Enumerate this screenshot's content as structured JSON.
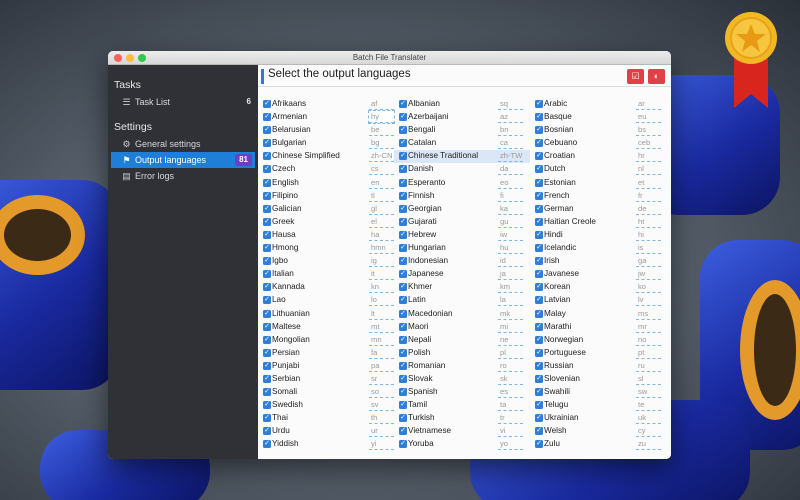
{
  "window": {
    "title": "Batch File Translater"
  },
  "sidebar": {
    "sections": [
      {
        "label": "Tasks",
        "items": [
          {
            "label": "Task List",
            "icon": "list-icon",
            "count": "6"
          }
        ]
      },
      {
        "label": "Settings",
        "items": [
          {
            "label": "General settings",
            "icon": "gear-icon"
          },
          {
            "label": "Output languages",
            "icon": "flag-icon",
            "count": "81",
            "selected": true
          },
          {
            "label": "Error logs",
            "icon": "document-icon"
          }
        ]
      }
    ]
  },
  "main": {
    "title": "Select the output languages",
    "buttons": [
      {
        "icon": "check-icon"
      },
      {
        "icon": "toggle-icon"
      }
    ],
    "accent": "#2f78d6"
  },
  "languages": [
    [
      [
        "Afrikaans",
        "af"
      ],
      [
        "Armenian",
        "hy"
      ],
      [
        "Belarusian",
        "be"
      ],
      [
        "Bulgarian",
        "bg"
      ],
      [
        "Chinese Simplified",
        "zh-CN"
      ],
      [
        "Czech",
        "cs"
      ],
      [
        "English",
        "en"
      ],
      [
        "Filipino",
        "tl"
      ],
      [
        "Galician",
        "gl"
      ],
      [
        "Greek",
        "el"
      ],
      [
        "Hausa",
        "ha"
      ],
      [
        "Hmong",
        "hmn"
      ],
      [
        "Igbo",
        "ig"
      ],
      [
        "Italian",
        "it"
      ],
      [
        "Kannada",
        "kn"
      ],
      [
        "Lao",
        "lo"
      ],
      [
        "Lithuanian",
        "lt"
      ],
      [
        "Maltese",
        "mt"
      ],
      [
        "Mongolian",
        "mn"
      ],
      [
        "Persian",
        "fa"
      ],
      [
        "Punjabi",
        "pa"
      ],
      [
        "Serbian",
        "sr"
      ],
      [
        "Somali",
        "so"
      ],
      [
        "Swedish",
        "sv"
      ],
      [
        "Thai",
        "th"
      ],
      [
        "Urdu",
        "ur"
      ],
      [
        "Yiddish",
        "yi"
      ]
    ],
    [
      [
        "Albanian",
        "sq"
      ],
      [
        "Azerbaijani",
        "az"
      ],
      [
        "Bengali",
        "bn"
      ],
      [
        "Catalan",
        "ca"
      ],
      [
        "Chinese Traditional",
        "zh-TW"
      ],
      [
        "Danish",
        "da"
      ],
      [
        "Esperanto",
        "eo"
      ],
      [
        "Finnish",
        "fi"
      ],
      [
        "Georgian",
        "ka"
      ],
      [
        "Gujarati",
        "gu"
      ],
      [
        "Hebrew",
        "iw"
      ],
      [
        "Hungarian",
        "hu"
      ],
      [
        "Indonesian",
        "id"
      ],
      [
        "Japanese",
        "ja"
      ],
      [
        "Khmer",
        "km"
      ],
      [
        "Latin",
        "la"
      ],
      [
        "Macedonian",
        "mk"
      ],
      [
        "Maori",
        "mi"
      ],
      [
        "Nepali",
        "ne"
      ],
      [
        "Polish",
        "pl"
      ],
      [
        "Romanian",
        "ro"
      ],
      [
        "Slovak",
        "sk"
      ],
      [
        "Spanish",
        "es"
      ],
      [
        "Tamil",
        "ta"
      ],
      [
        "Turkish",
        "tr"
      ],
      [
        "Vietnamese",
        "vi"
      ],
      [
        "Yoruba",
        "yo"
      ]
    ],
    [
      [
        "Arabic",
        "ar"
      ],
      [
        "Basque",
        "eu"
      ],
      [
        "Bosnian",
        "bs"
      ],
      [
        "Cebuano",
        "ceb"
      ],
      [
        "Croatian",
        "hr"
      ],
      [
        "Dutch",
        "nl"
      ],
      [
        "Estonian",
        "et"
      ],
      [
        "French",
        "fr"
      ],
      [
        "German",
        "de"
      ],
      [
        "Haitian Creole",
        "ht"
      ],
      [
        "Hindi",
        "hi"
      ],
      [
        "Icelandic",
        "is"
      ],
      [
        "Irish",
        "ga"
      ],
      [
        "Javanese",
        "jw"
      ],
      [
        "Korean",
        "ko"
      ],
      [
        "Latvian",
        "lv"
      ],
      [
        "Malay",
        "ms"
      ],
      [
        "Marathi",
        "mr"
      ],
      [
        "Norwegian",
        "no"
      ],
      [
        "Portuguese",
        "pt"
      ],
      [
        "Russian",
        "ru"
      ],
      [
        "Slovenian",
        "sl"
      ],
      [
        "Swahili",
        "sw"
      ],
      [
        "Telugu",
        "te"
      ],
      [
        "Ukrainian",
        "uk"
      ],
      [
        "Welsh",
        "cy"
      ],
      [
        "Zulu",
        "zu"
      ]
    ]
  ],
  "highlighted": "Chinese Traditional",
  "focused_code": "hy"
}
